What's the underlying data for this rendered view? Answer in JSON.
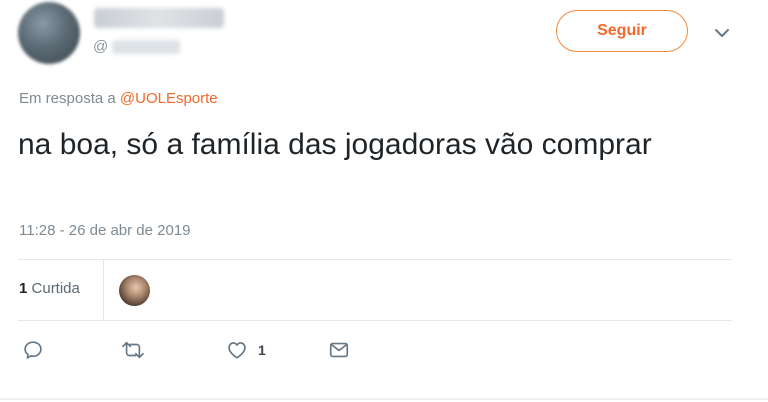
{
  "header": {
    "handle_prefix": "@",
    "follow_label": "Seguir"
  },
  "reply": {
    "prefix": "Em resposta a ",
    "mention": "@UOLEsporte"
  },
  "tweet": {
    "text": "na boa, só a família das jogadoras vão comprar",
    "timestamp": "11:28 - 26 de abr de 2019"
  },
  "stats": {
    "likes_count": "1",
    "likes_label": "Curtida"
  },
  "actions": {
    "reply_icon": "reply-icon",
    "retweet_icon": "retweet-icon",
    "like_icon": "heart-icon",
    "like_count": "1",
    "dm_icon": "envelope-icon"
  },
  "colors": {
    "accent": "#f2692a",
    "muted": "#7f8a93",
    "text": "#1f2428"
  }
}
